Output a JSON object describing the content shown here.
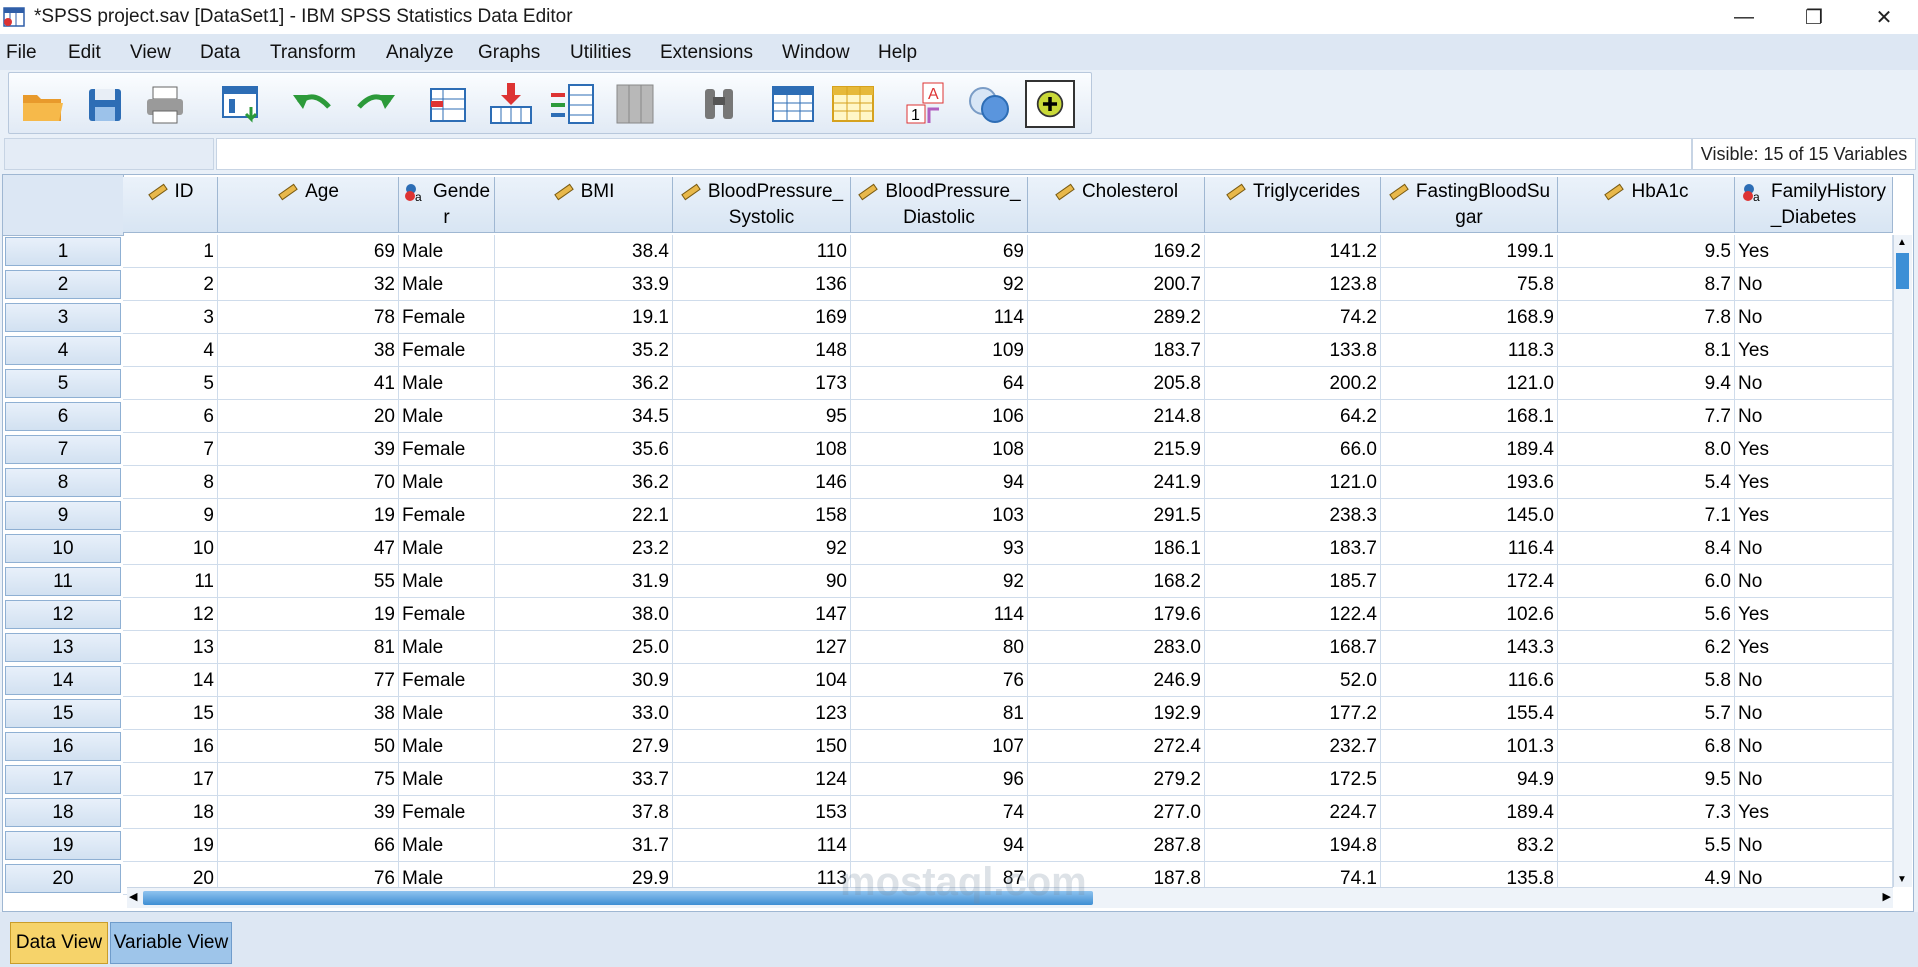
{
  "window": {
    "title": "*SPSS project.sav [DataSet1] - IBM SPSS Statistics Data Editor",
    "minimize": "—",
    "restore": "❐",
    "close": "✕"
  },
  "menu": [
    "File",
    "Edit",
    "View",
    "Data",
    "Transform",
    "Analyze",
    "Graphs",
    "Utilities",
    "Extensions",
    "Window",
    "Help"
  ],
  "toolbar_icons": [
    "open-folder-icon",
    "save-icon",
    "print-icon",
    "dialog-recall-icon",
    "undo-icon",
    "redo-icon",
    "goto-case-icon",
    "goto-variable-icon",
    "variables-icon",
    "run-descriptives-icon",
    "find-icon",
    "insert-cases-icon",
    "insert-variable-icon",
    "split-file-icon",
    "value-labels-icon",
    "use-variable-sets-icon"
  ],
  "cell_editor": {
    "ref": "",
    "value": ""
  },
  "visible_vars": "Visible: 15 of 15 Variables",
  "columns": [
    {
      "name": "ID",
      "line2": "",
      "type": "scale"
    },
    {
      "name": "Age",
      "line2": "",
      "type": "scale"
    },
    {
      "name": "Gende",
      "line2": "r",
      "type": "nominal"
    },
    {
      "name": "BMI",
      "line2": "",
      "type": "scale"
    },
    {
      "name": "BloodPressure_",
      "line2": "Systolic",
      "type": "scale"
    },
    {
      "name": "BloodPressure_",
      "line2": "Diastolic",
      "type": "scale"
    },
    {
      "name": "Cholesterol",
      "line2": "",
      "type": "scale"
    },
    {
      "name": "Triglycerides",
      "line2": "",
      "type": "scale"
    },
    {
      "name": "FastingBloodSu",
      "line2": "gar",
      "type": "scale"
    },
    {
      "name": "HbA1c",
      "line2": "",
      "type": "scale"
    },
    {
      "name": "FamilyHistory",
      "line2": "_Diabetes",
      "type": "nominal"
    }
  ],
  "rows": [
    [
      "1",
      "1",
      "69",
      "Male",
      "38.4",
      "110",
      "69",
      "169.2",
      "141.2",
      "199.1",
      "9.5",
      "Yes"
    ],
    [
      "2",
      "2",
      "32",
      "Male",
      "33.9",
      "136",
      "92",
      "200.7",
      "123.8",
      "75.8",
      "8.7",
      "No"
    ],
    [
      "3",
      "3",
      "78",
      "Female",
      "19.1",
      "169",
      "114",
      "289.2",
      "74.2",
      "168.9",
      "7.8",
      "No"
    ],
    [
      "4",
      "4",
      "38",
      "Female",
      "35.2",
      "148",
      "109",
      "183.7",
      "133.8",
      "118.3",
      "8.1",
      "Yes"
    ],
    [
      "5",
      "5",
      "41",
      "Male",
      "36.2",
      "173",
      "64",
      "205.8",
      "200.2",
      "121.0",
      "9.4",
      "No"
    ],
    [
      "6",
      "6",
      "20",
      "Male",
      "34.5",
      "95",
      "106",
      "214.8",
      "64.2",
      "168.1",
      "7.7",
      "No"
    ],
    [
      "7",
      "7",
      "39",
      "Female",
      "35.6",
      "108",
      "108",
      "215.9",
      "66.0",
      "189.4",
      "8.0",
      "Yes"
    ],
    [
      "8",
      "8",
      "70",
      "Male",
      "36.2",
      "146",
      "94",
      "241.9",
      "121.0",
      "193.6",
      "5.4",
      "Yes"
    ],
    [
      "9",
      "9",
      "19",
      "Female",
      "22.1",
      "158",
      "103",
      "291.5",
      "238.3",
      "145.0",
      "7.1",
      "Yes"
    ],
    [
      "10",
      "10",
      "47",
      "Male",
      "23.2",
      "92",
      "93",
      "186.1",
      "183.7",
      "116.4",
      "8.4",
      "No"
    ],
    [
      "11",
      "11",
      "55",
      "Male",
      "31.9",
      "90",
      "92",
      "168.2",
      "185.7",
      "172.4",
      "6.0",
      "No"
    ],
    [
      "12",
      "12",
      "19",
      "Female",
      "38.0",
      "147",
      "114",
      "179.6",
      "122.4",
      "102.6",
      "5.6",
      "Yes"
    ],
    [
      "13",
      "13",
      "81",
      "Male",
      "25.0",
      "127",
      "80",
      "283.0",
      "168.7",
      "143.3",
      "6.2",
      "Yes"
    ],
    [
      "14",
      "14",
      "77",
      "Female",
      "30.9",
      "104",
      "76",
      "246.9",
      "52.0",
      "116.6",
      "5.8",
      "No"
    ],
    [
      "15",
      "15",
      "38",
      "Male",
      "33.0",
      "123",
      "81",
      "192.9",
      "177.2",
      "155.4",
      "5.7",
      "No"
    ],
    [
      "16",
      "16",
      "50",
      "Male",
      "27.9",
      "150",
      "107",
      "272.4",
      "232.7",
      "101.3",
      "6.8",
      "No"
    ],
    [
      "17",
      "17",
      "75",
      "Male",
      "33.7",
      "124",
      "96",
      "279.2",
      "172.5",
      "94.9",
      "9.5",
      "No"
    ],
    [
      "18",
      "18",
      "39",
      "Female",
      "37.8",
      "153",
      "74",
      "277.0",
      "224.7",
      "189.4",
      "7.3",
      "Yes"
    ],
    [
      "19",
      "19",
      "66",
      "Male",
      "31.7",
      "114",
      "94",
      "287.8",
      "194.8",
      "83.2",
      "5.5",
      "No"
    ],
    [
      "20",
      "20",
      "76",
      "Male",
      "29.9",
      "113",
      "87",
      "187.8",
      "74.1",
      "135.8",
      "4.9",
      "No"
    ]
  ],
  "tabs": {
    "data_view": "Data View",
    "variable_view": "Variable View"
  },
  "watermark": "mostaql.com",
  "colors": {
    "selected_tab": "#f6d36a",
    "inactive_tab": "#9ec5ea",
    "header_bg": "#d8e5f3"
  }
}
